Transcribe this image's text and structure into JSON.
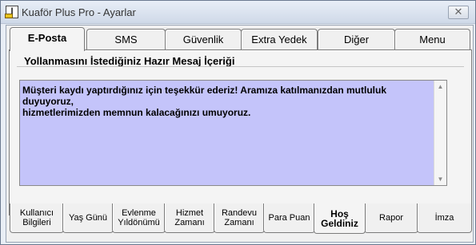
{
  "window": {
    "title": "Kuaför Plus Pro - Ayarlar",
    "close_label": "✕"
  },
  "top_tabs": [
    "E-Posta",
    "SMS",
    "Güvenlik",
    "Extra Yedek",
    "Diğer",
    "Menu"
  ],
  "active_top_tab": "E-Posta",
  "group": {
    "title": "Yollanmasını İstediğiniz Hazır Mesaj İçeriği",
    "message": "Müşteri kaydı yaptırdığınız için teşekkür ederiz! Aramıza katılmanızdan mutluluk duyuyoruz,\nhizmetlerimizden memnun kalacağınızı umuyoruz.",
    "textarea_color": "#c4c4fa"
  },
  "bottom_tabs": [
    "Kullanıcı\nBilgileri",
    "Yaş Günü",
    "Evlenme\nYıldönümü",
    "Hizmet\nZamanı",
    "Randevu\nZamanı",
    "Para Puan",
    "Hoş\nGeldiniz",
    "Rapor",
    "İmza"
  ],
  "active_bottom_tab": "Hoş\nGeldiniz",
  "icons": {
    "app": "app-icon",
    "scroll_up": "▲",
    "scroll_down": "▼"
  }
}
